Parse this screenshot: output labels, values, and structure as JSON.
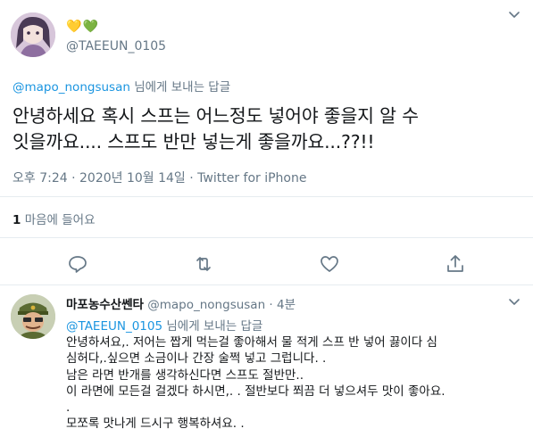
{
  "tweet": {
    "hearts": [
      "💛",
      "💚"
    ],
    "handle": "@TAEEUN_0105",
    "replying_handle": "@mapo_nongsusan",
    "replying_suffix": " 님에게 보내는 답글",
    "text_line1": "안녕하세요 혹시 스프는 어느정도 넣어야 좋을지 알 수",
    "text_line2": "잇을까요....  스프도 반만 넣는게 좋을까요...??!!",
    "meta": "오후 7:24 · 2020년 10월 14일 · Twitter for iPhone",
    "likes_count": "1",
    "likes_label": " 마음에 들어요"
  },
  "actions": {
    "reply": "reply-icon",
    "retweet": "retweet-icon",
    "like": "heart-icon",
    "share": "share-icon"
  },
  "reply": {
    "name": "마포농수산쎈타",
    "handle": " @mapo_nongsusan",
    "time": " · 4분",
    "replying_handle": "@TAEEUN_0105",
    "replying_suffix": " 님에게 보내는 답글",
    "lines": [
      "안녕하셔요,. 저어는 짭게 먹는걸 좋아해서 물 적게 스프 반 넣어 끓이다 심",
      "심허다,.싶으면 소금이나 간장 술쩍 넣고 그럽니다. .",
      "남은 라면 반개를 생각하신다면 스프도 절반만..",
      "이 라면에 모든걸 걸겠다 하시면,. . 절반보다 쬐끔 더 넣으셔두 맛이 좋아요.",
      ".",
      "모쪼록 맛나게 드시구 행복하셔요. ."
    ]
  },
  "colors": {
    "accent": "#1b95e0",
    "secondary": "#657786",
    "divider": "#e6ecf0"
  }
}
